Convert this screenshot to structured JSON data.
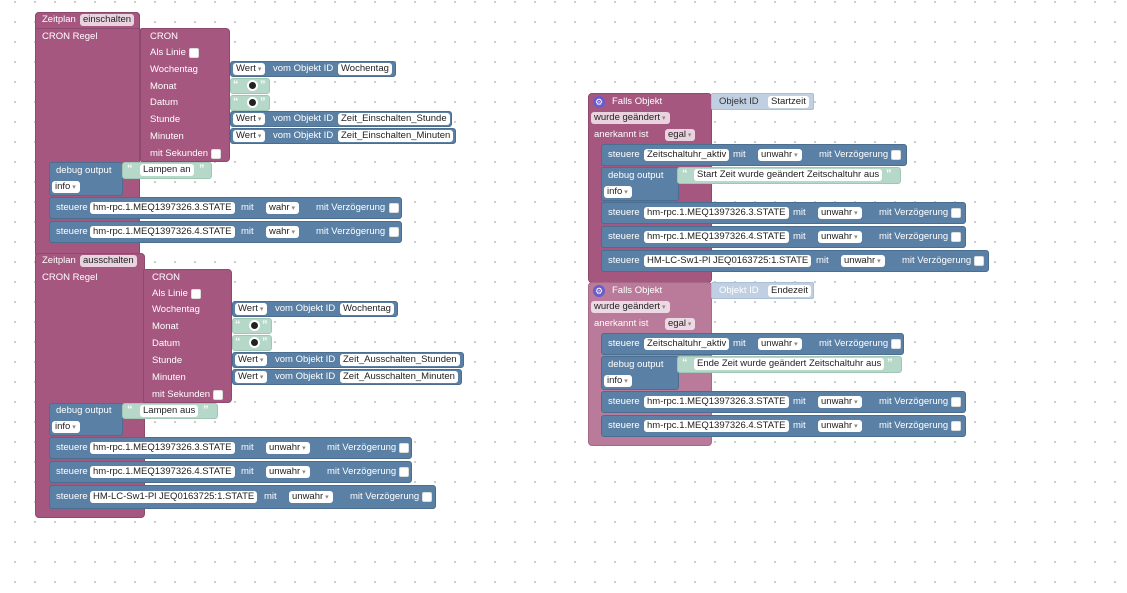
{
  "zeitplan_on": {
    "title": "Zeitplan",
    "name": "einschalten",
    "cron_label": "CRON Regel",
    "cron_title": "CRON",
    "als_linie": "Als Linie",
    "rows": [
      {
        "label": "Wochentag",
        "mode": "Wert",
        "vom": "vom Objekt ID",
        "object": "Wochentag"
      },
      {
        "label": "Monat"
      },
      {
        "label": "Datum"
      },
      {
        "label": "Stunde",
        "mode": "Wert",
        "vom": "vom Objekt ID",
        "object": "Zeit_Einschalten_Stunde"
      },
      {
        "label": "Minuten",
        "mode": "Wert",
        "vom": "vom Objekt ID",
        "object": "Zeit_Einschalten_Minuten"
      }
    ],
    "mit_sekunden": "mit Sekunden",
    "debug": {
      "label": "debug output",
      "text": "Lampen an",
      "level": "info"
    },
    "steuere": [
      {
        "label": "steuere",
        "object": "hm-rpc.1.MEQ1397326.3.STATE",
        "mit": "mit",
        "value": "wahr",
        "delay": "mit Verzögerung"
      },
      {
        "label": "steuere",
        "object": "hm-rpc.1.MEQ1397326.4.STATE",
        "mit": "mit",
        "value": "wahr",
        "delay": "mit Verzögerung"
      }
    ]
  },
  "zeitplan_off": {
    "title": "Zeitplan",
    "name": "ausschalten",
    "cron_label": "CRON Regel",
    "cron_title": "CRON",
    "als_linie": "Als Linie",
    "rows": [
      {
        "label": "Wochentag",
        "mode": "Wert",
        "vom": "vom Objekt ID",
        "object": "Wochentag"
      },
      {
        "label": "Monat"
      },
      {
        "label": "Datum"
      },
      {
        "label": "Stunde",
        "mode": "Wert",
        "vom": "vom Objekt ID",
        "object": "Zeit_Ausschalten_Stunden"
      },
      {
        "label": "Minuten",
        "mode": "Wert",
        "vom": "vom Objekt ID",
        "object": "Zeit_Ausschalten_Minuten"
      }
    ],
    "mit_sekunden": "mit Sekunden",
    "debug": {
      "label": "debug output",
      "text": "Lampen aus",
      "level": "info"
    },
    "steuere": [
      {
        "label": "steuere",
        "object": "hm-rpc.1.MEQ1397326.3.STATE",
        "mit": "mit",
        "value": "unwahr",
        "delay": "mit Verzögerung"
      },
      {
        "label": "steuere",
        "object": "hm-rpc.1.MEQ1397326.4.STATE",
        "mit": "mit",
        "value": "unwahr",
        "delay": "mit Verzögerung"
      },
      {
        "label": "steuere",
        "object": "HM-LC-Sw1-Pl JEQ0163725:1.STATE",
        "mit": "mit",
        "value": "unwahr",
        "delay": "mit Verzögerung"
      }
    ]
  },
  "trigger_start": {
    "title": "Falls Objekt",
    "objekt_id": "Objekt ID",
    "object": "Startzeit",
    "event": "wurde geändert",
    "anerkannt": "anerkannt ist",
    "anerkannt_value": "egal",
    "steuere_first": {
      "label": "steuere",
      "object": "Zeitschaltuhr_aktiv",
      "mit": "mit",
      "value": "unwahr",
      "delay": "mit Verzögerung"
    },
    "debug": {
      "label": "debug output",
      "text": "Start Zeit wurde geändert Zeitschaltuhr aus",
      "level": "info"
    },
    "steuere": [
      {
        "label": "steuere",
        "object": "hm-rpc.1.MEQ1397326.3.STATE",
        "mit": "mit",
        "value": "unwahr",
        "delay": "mit Verzögerung"
      },
      {
        "label": "steuere",
        "object": "hm-rpc.1.MEQ1397326.4.STATE",
        "mit": "mit",
        "value": "unwahr",
        "delay": "mit Verzögerung"
      },
      {
        "label": "steuere",
        "object": "HM-LC-Sw1-Pl JEQ0163725:1.STATE",
        "mit": "mit",
        "value": "unwahr",
        "delay": "mit Verzögerung"
      }
    ]
  },
  "trigger_end": {
    "title": "Falls Objekt",
    "objekt_id": "Objekt ID",
    "object": "Endezeit",
    "event": "wurde geändert",
    "anerkannt": "anerkannt ist",
    "anerkannt_value": "egal",
    "steuere_first": {
      "label": "steuere",
      "object": "Zeitschaltuhr_aktiv",
      "mit": "mit",
      "value": "unwahr",
      "delay": "mit Verzögerung"
    },
    "debug": {
      "label": "debug output",
      "text": "Ende Zeit wurde geändert Zeitschaltuhr aus",
      "level": "info"
    },
    "steuere": [
      {
        "label": "steuere",
        "object": "hm-rpc.1.MEQ1397326.3.STATE",
        "mit": "mit",
        "value": "unwahr",
        "delay": "mit Verzögerung"
      },
      {
        "label": "steuere",
        "object": "hm-rpc.1.MEQ1397326.4.STATE",
        "mit": "mit",
        "value": "unwahr",
        "delay": "mit Verzögerung"
      }
    ]
  },
  "colors": {
    "trigger": "#a5577f",
    "action": "#5b80a5",
    "text_block": "#b6d8c9",
    "object_id": "#c0d0e2",
    "workspace": "#ffffff"
  },
  "icons": {
    "trigger_gear": "gear-icon",
    "quote_open": "“",
    "quote_close": "”"
  }
}
